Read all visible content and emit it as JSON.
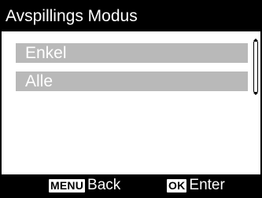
{
  "header": {
    "title": "Avspillings Modus"
  },
  "menu": {
    "items": [
      {
        "label": "Enkel"
      },
      {
        "label": "Alle"
      }
    ]
  },
  "footer": {
    "back_key": "MENU",
    "back_label": "Back",
    "enter_key": "OK",
    "enter_label": "Enter"
  },
  "colors": {
    "background": "#ffffff",
    "bars": "#000000",
    "item_highlight": "#b9b9b9",
    "text_light": "#ffffff"
  }
}
